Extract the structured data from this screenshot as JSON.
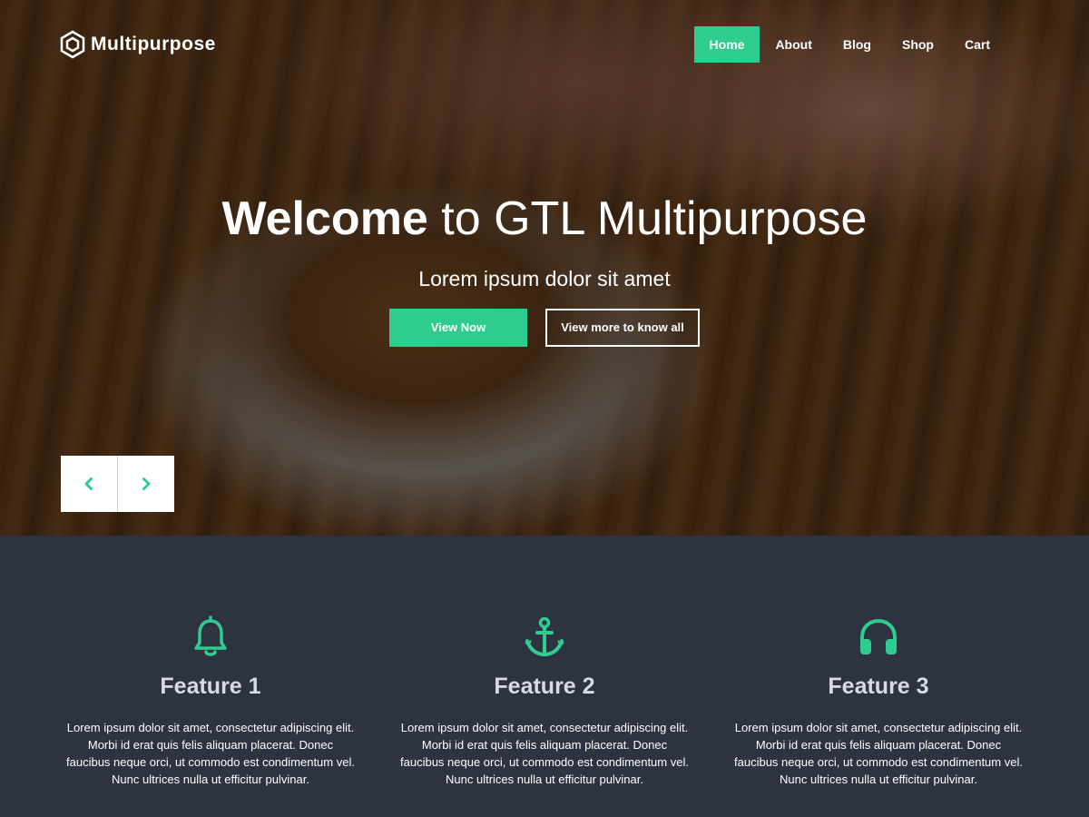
{
  "brand": {
    "name": "Multipurpose",
    "accent": "#2fcc8f",
    "icon": "hexagon-logo-icon"
  },
  "nav": {
    "items": [
      {
        "label": "Home",
        "active": true
      },
      {
        "label": "About",
        "active": false
      },
      {
        "label": "Blog",
        "active": false
      },
      {
        "label": "Shop",
        "active": false
      },
      {
        "label": "Cart",
        "active": false
      }
    ]
  },
  "hero": {
    "title_bold": "Welcome",
    "title_rest": " to GTL Multipurpose",
    "subtitle": "Lorem ipsum dolor sit amet",
    "primary_button": "View Now",
    "secondary_button": "View more to know all",
    "prev_icon": "chevron-left-icon",
    "next_icon": "chevron-right-icon"
  },
  "features": [
    {
      "icon": "bell-icon",
      "title": "Feature 1",
      "text": "Lorem ipsum dolor sit amet, consectetur adipiscing elit. Morbi id erat quis felis aliquam placerat. Donec faucibus neque orci, ut commodo est condimentum vel. Nunc ultrices nulla ut efficitur pulvinar."
    },
    {
      "icon": "anchor-icon",
      "title": "Feature 2",
      "text": "Lorem ipsum dolor sit amet, consectetur adipiscing elit. Morbi id erat quis felis aliquam placerat. Donec faucibus neque orci, ut commodo est condimentum vel. Nunc ultrices nulla ut efficitur pulvinar."
    },
    {
      "icon": "headphones-icon",
      "title": "Feature 3",
      "text": "Lorem ipsum dolor sit amet, consectetur adipiscing elit. Morbi id erat quis felis aliquam placerat. Donec faucibus neque orci, ut commodo est condimentum vel. Nunc ultrices nulla ut efficitur pulvinar."
    }
  ]
}
